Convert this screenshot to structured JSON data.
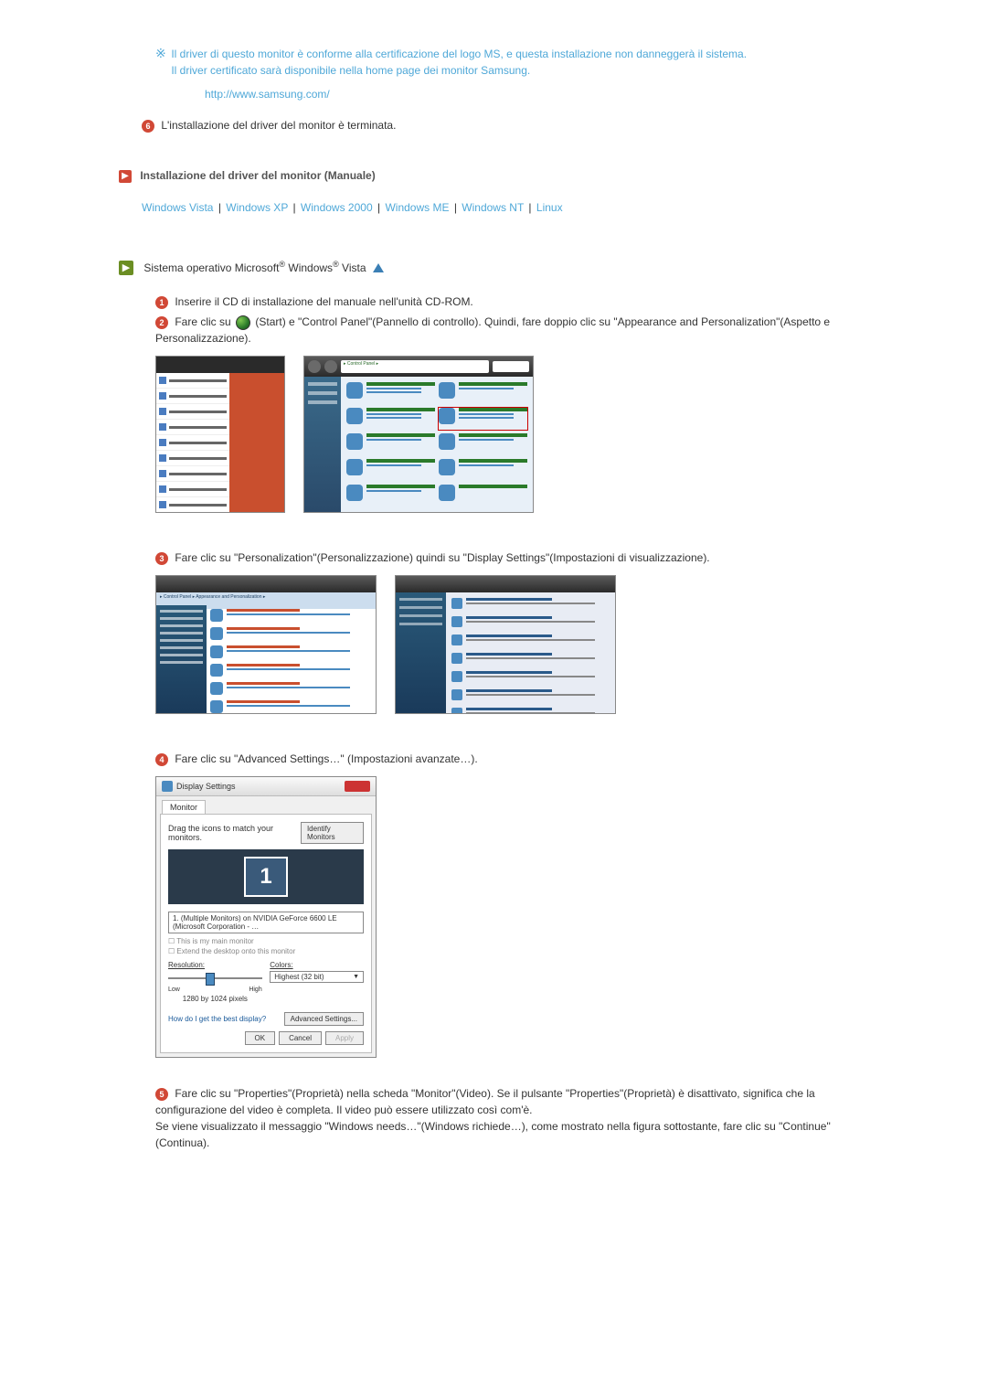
{
  "note": {
    "line1": "Il driver di questo monitor è conforme alla certificazione del logo MS, e questa installazione non danneggerà il sistema.",
    "line2": "Il driver certificato sarà disponibile nella home page dei monitor Samsung.",
    "url": "http://www.samsung.com/"
  },
  "step6": "L'installazione del driver del monitor è terminata.",
  "section_manual": {
    "title": "Installazione del driver del monitor (Manuale)",
    "os_links": [
      "Windows Vista",
      "Windows XP",
      "Windows 2000",
      "Windows ME",
      "Windows NT",
      "Linux"
    ]
  },
  "vista": {
    "heading_prefix": "Sistema operativo Microsoft",
    "heading_mid": " Windows",
    "heading_suffix": " Vista",
    "step1": "Inserire il CD di installazione del manuale nell'unità CD-ROM.",
    "step2a": "Fare clic su ",
    "step2b": "(Start) e \"Control Panel\"(Pannello di controllo). Quindi, fare doppio clic su \"Appearance and Personalization\"(Aspetto e Personalizzazione).",
    "step3": "Fare clic su \"Personalization\"(Personalizzazione) quindi su \"Display Settings\"(Impostazioni di visualizzazione).",
    "step4": "Fare clic su \"Advanced Settings…\" (Impostazioni avanzate…).",
    "step5": "Fare clic su \"Properties\"(Proprietà) nella scheda \"Monitor\"(Video). Se il pulsante \"Properties\"(Proprietà) è disattivato, significa che la configurazione del video è completa. Il video può essere utilizzato così com'è.\nSe viene visualizzato il messaggio \"Windows needs…\"(Windows richiede…), come mostrato nella figura sottostante, fare clic su \"Continue\"(Continua)."
  },
  "display_settings_dialog": {
    "title": "Display Settings",
    "tab": "Monitor",
    "drag_text": "Drag the icons to match your monitors.",
    "identify_btn": "Identify Monitors",
    "monitor_number": "1",
    "dropdown": "1. (Multiple Monitors) on NVIDIA GeForce 6600 LE (Microsoft Corporation - …",
    "chk1": "This is my main monitor",
    "chk2": "Extend the desktop onto this monitor",
    "resolution_label": "Resolution:",
    "res_low": "Low",
    "res_high": "High",
    "res_value": "1280 by 1024 pixels",
    "colors_label": "Colors:",
    "colors_value": "Highest (32 bit)",
    "help_link": "How do I get the best display?",
    "advanced_btn": "Advanced Settings...",
    "ok": "OK",
    "cancel": "Cancel",
    "apply": "Apply"
  }
}
